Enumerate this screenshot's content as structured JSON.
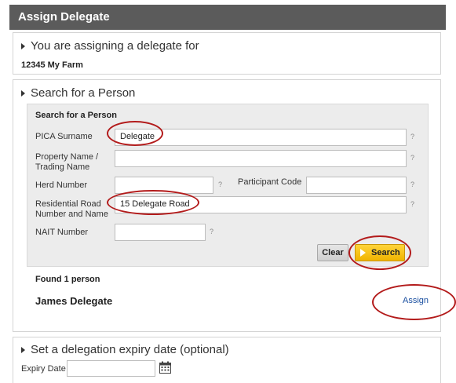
{
  "window": {
    "title": "Assign Delegate"
  },
  "assigning": {
    "heading": "You are assigning a delegate for",
    "farm": "12345 My Farm"
  },
  "search_section": {
    "heading": "Search for a Person",
    "box_title": "Search for a Person",
    "fields": {
      "pica_surname": {
        "label": "PICA Surname",
        "value": "Delegate",
        "help": "?"
      },
      "property_name": {
        "label_line1": "Property Name /",
        "label_line2": "Trading Name",
        "value": "",
        "help": "?"
      },
      "herd_number": {
        "label": "Herd Number",
        "value": "",
        "help": "?"
      },
      "participant_code": {
        "label": "Participant Code",
        "value": "",
        "help": "?"
      },
      "residential_road": {
        "label_line1": "Residential Road",
        "label_line2": "Number and Name",
        "value": "15 Delegate Road",
        "help": "?"
      },
      "nait_number": {
        "label": "NAIT Number",
        "value": "",
        "help": "?"
      }
    },
    "buttons": {
      "clear": "Clear",
      "search": "Search"
    },
    "result_count": "Found 1 person",
    "results": [
      {
        "name": "James Delegate",
        "action": "Assign"
      }
    ]
  },
  "expiry_section": {
    "heading": "Set a delegation expiry date (optional)",
    "label": "Expiry Date",
    "value": "",
    "icon": "calendar-icon"
  },
  "colors": {
    "title_bg": "#5b5b5b",
    "search_btn": "#f5bd0a",
    "highlight_ring": "#b31b1b",
    "link": "#1a4fa0"
  }
}
